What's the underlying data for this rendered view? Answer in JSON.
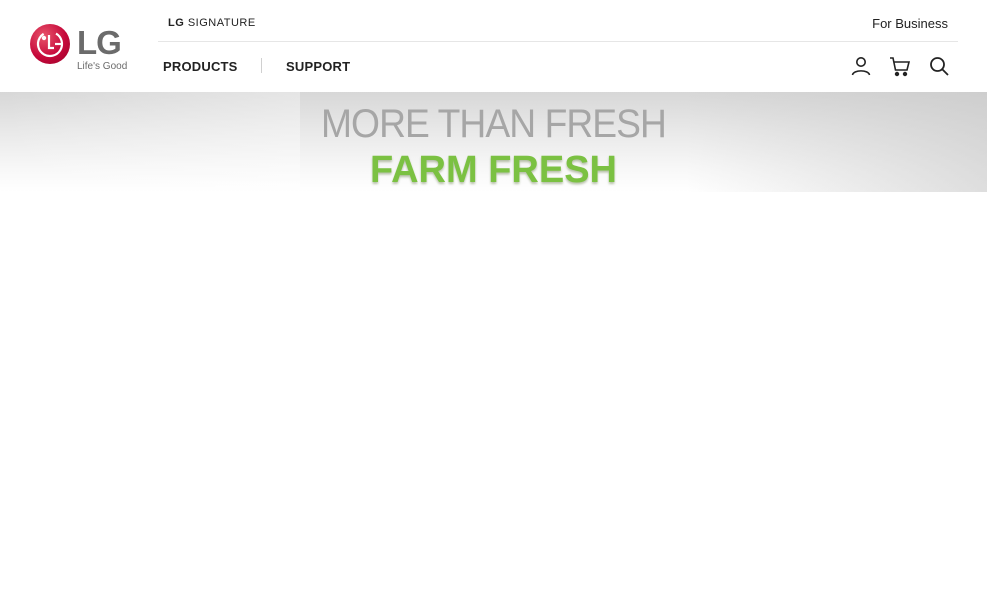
{
  "header": {
    "logo": {
      "wordmark": "LG",
      "tagline": "Life's Good",
      "brand_color": "#c6093b"
    },
    "topbar": {
      "signature_brand": "LG",
      "signature_label": "SIGNATURE",
      "for_business": "For Business"
    },
    "nav": {
      "items": [
        {
          "label": "PRODUCTS"
        },
        {
          "label": "SUPPORT"
        }
      ]
    },
    "utility_icons": [
      "user-icon",
      "cart-icon",
      "search-icon"
    ]
  },
  "hero": {
    "line1": "MORE THAN FRESH",
    "line2": "FARM FRESH",
    "line1_color": "#a6a6a6",
    "line2_color": "#7bc142"
  }
}
